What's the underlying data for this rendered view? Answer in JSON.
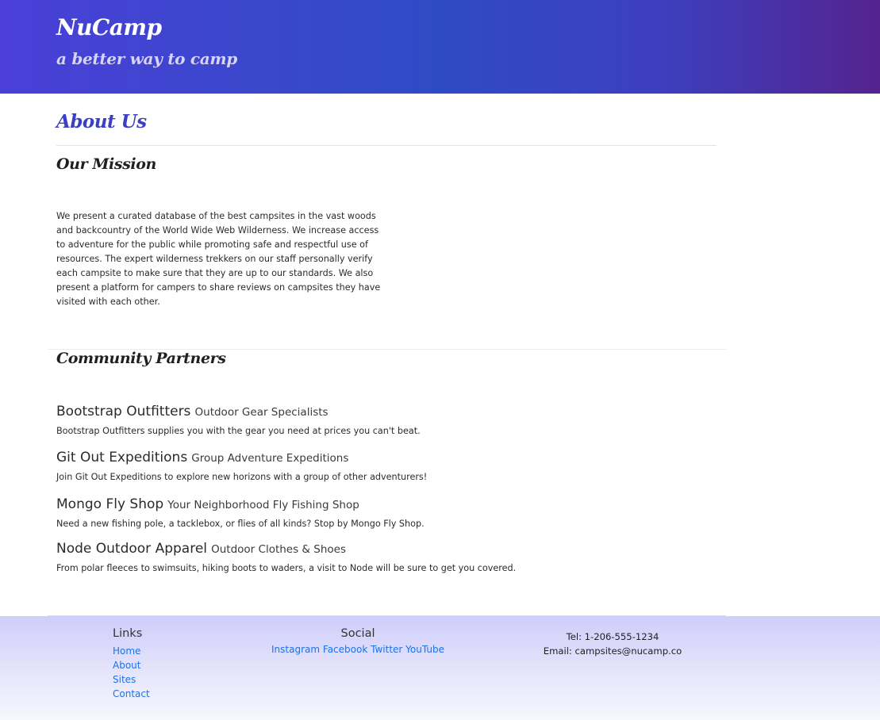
{
  "header": {
    "brand": "NuCamp",
    "tagline": "a better way to camp"
  },
  "main": {
    "title": "About Us",
    "mission": {
      "heading": "Our Mission",
      "text": "We present a curated database of the best campsites in the vast woods and backcountry of the World Wide Web Wilderness. We increase access to adventure for the public while promoting safe and respectful use of resources. The expert wilderness trekkers on our staff personally verify each campsite to make sure that they are up to our standards. We also present a platform for campers to share reviews on campsites they have visited with each other."
    },
    "partners": {
      "heading": "Community Partners",
      "items": [
        {
          "name": "Bootstrap Outfitters",
          "subtitle": "Outdoor Gear Specialists",
          "description": "Bootstrap Outfitters supplies you with the gear you need at prices you can't beat."
        },
        {
          "name": "Git Out Expeditions",
          "subtitle": "Group Adventure Expeditions",
          "description": "Join Git Out Expeditions to explore new horizons with a group of other adventurers!"
        },
        {
          "name": "Mongo Fly Shop",
          "subtitle": "Your Neighborhood Fly Fishing Shop",
          "description": "Need a new fishing pole, a tacklebox, or flies of all kinds? Stop by Mongo Fly Shop."
        },
        {
          "name": "Node Outdoor Apparel",
          "subtitle": "Outdoor Clothes & Shoes",
          "description": "From polar fleeces to swimsuits, hiking boots to waders, a visit to Node will be sure to get you covered."
        }
      ]
    }
  },
  "footer": {
    "links": {
      "heading": "Links",
      "items": [
        "Home",
        "About",
        "Sites",
        "Contact"
      ]
    },
    "social": {
      "heading": "Social",
      "items": [
        "Instagram",
        "Facebook",
        "Twitter",
        "YouTube"
      ]
    },
    "contact": {
      "phone": "Tel: 1-206-555-1234",
      "email": "Email: campsites@nucamp.co"
    }
  },
  "colors": {
    "header_gradient_start": "#4a3fd8",
    "header_gradient_end": "#54238f",
    "page_title": "#3a3fc4",
    "link": "#1a73e8",
    "footer_gradient_top": "#cfcdfb"
  }
}
